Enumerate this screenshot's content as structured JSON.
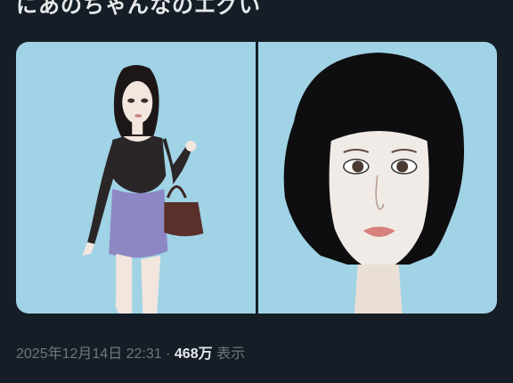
{
  "tweet": {
    "text": "にあのちゃんなのエグい"
  },
  "media": [
    {
      "label": "woman-full-body-illustration"
    },
    {
      "label": "woman-portrait-illustration"
    }
  ],
  "meta": {
    "timestamp": "2025年12月14日 22:31",
    "separator": " · ",
    "views_count": "468万",
    "views_label": "表示"
  },
  "colors": {
    "background": "#151d26",
    "image_background": "#9fd3e5",
    "meta_text": "#71767b",
    "primary_text": "#e7e9ea"
  }
}
